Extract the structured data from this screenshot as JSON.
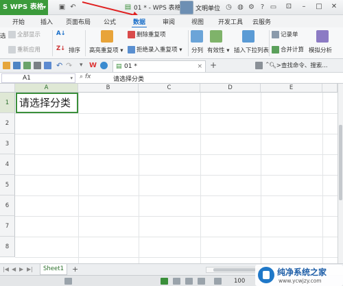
{
  "titlebar": {
    "app_button": "WPS 表格",
    "doc_title": "01 * - WPS 表格",
    "user_name": "文明单位"
  },
  "tabs": [
    "开始",
    "插入",
    "页面布局",
    "公式",
    "数据",
    "审阅",
    "视图",
    "开发工具",
    "云服务"
  ],
  "active_tab": "数据",
  "ribbon": {
    "show_all": "全部显示",
    "reapply": "重新应用",
    "filter_partial": "选",
    "sort": "排序",
    "highlight_dup": "高亮重复项",
    "delete_dup": "删除重复项",
    "reject_dup": "拒绝录入重复项",
    "split": "分列",
    "validity": "有效性",
    "insert_dropdown": "插入下拉列表",
    "record_list": "记录单",
    "consolidate": "合并计算",
    "simulate": "模拟分析"
  },
  "doc_tab": {
    "name": "01 *",
    "close": "×"
  },
  "new_tab": "+",
  "search_hint": ">查找命令、搜索...",
  "formula_bar": {
    "cell_ref": "A1",
    "fx": "fx",
    "value": "请选择分类"
  },
  "columns": [
    "A",
    "B",
    "C",
    "D",
    "E"
  ],
  "rows": [
    "1",
    "2",
    "3",
    "4",
    "5",
    "6",
    "7",
    "8"
  ],
  "cells": {
    "A1": "请选择分类"
  },
  "sheets": [
    "Sheet1"
  ],
  "add_sheet": "+",
  "zoom": "100",
  "watermark": {
    "title": "纯净系统之家",
    "url": "www.ycwjzy.com"
  }
}
